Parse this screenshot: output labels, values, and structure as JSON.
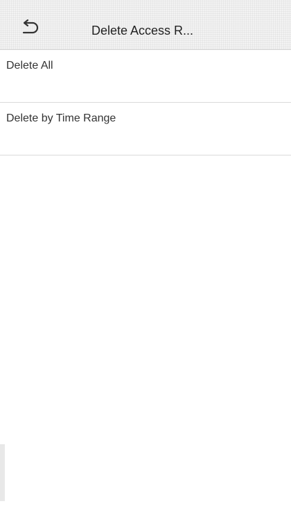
{
  "header": {
    "back_icon": "back-arrow-icon",
    "title": "Delete Access R..."
  },
  "menu": {
    "items": [
      {
        "label": "Delete All"
      },
      {
        "label": "Delete by Time Range"
      }
    ]
  }
}
